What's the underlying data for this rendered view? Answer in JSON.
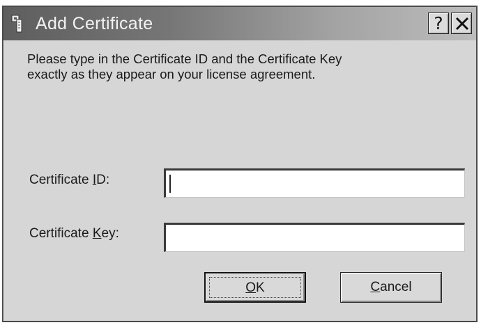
{
  "window": {
    "title": "Add Certificate",
    "help_label": "?",
    "icon": "certificate-app-icon",
    "close_icon": "close-icon"
  },
  "instructions": "Please type in the Certificate ID and the Certificate Key exactly as they appear on your license agreement.",
  "fields": {
    "certificate_id": {
      "label_before": "Certificate ",
      "label_accel": "I",
      "label_after": "D:",
      "value": ""
    },
    "certificate_key": {
      "label_before": "Certificate ",
      "label_accel": "K",
      "label_after": "ey:",
      "value": ""
    }
  },
  "buttons": {
    "ok": {
      "accel": "O",
      "rest": "K"
    },
    "cancel": {
      "accel": "C",
      "rest": "ancel"
    }
  }
}
